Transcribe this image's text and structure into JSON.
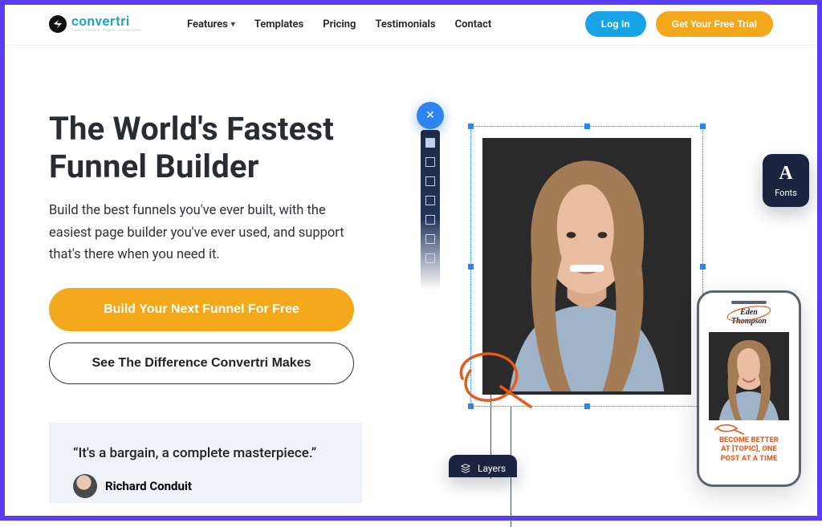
{
  "brand": {
    "name": "convertri",
    "tagline": "Faster funnels. Higher conversions."
  },
  "nav": {
    "features": "Features",
    "templates": "Templates",
    "pricing": "Pricing",
    "testimonials": "Testimonials",
    "contact": "Contact"
  },
  "header": {
    "login": "Log In",
    "trial": "Get Your Free Trial"
  },
  "hero": {
    "title_l1": "The World's Fastest",
    "title_l2": "Funnel Builder",
    "subtitle": "Build the best funnels you've ever built, with the easiest page builder you've ever used, and support that's there when you need it.",
    "cta_primary": "Build Your Next Funnel For Free",
    "cta_secondary": "See The Difference Convertri Makes"
  },
  "testimonial": {
    "quote": "“It's a bargain, a complete masterpiece.”",
    "name": "Richard Conduit"
  },
  "chips": {
    "fonts": "Fonts",
    "layers": "Layers"
  },
  "close_glyph": "✕",
  "phone": {
    "name_l1": "Eden",
    "name_l2": "Thompson",
    "cta_l1": "BECOME BETTER",
    "cta_l2": "AT [TOPIC], ONE",
    "cta_l3": "POST AT A TIME"
  }
}
